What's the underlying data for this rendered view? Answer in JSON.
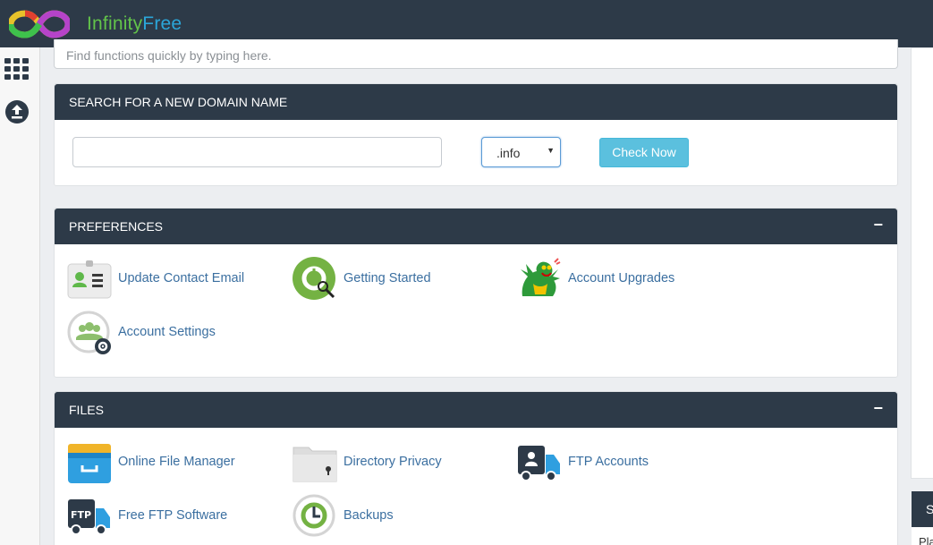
{
  "header": {
    "brand_part1": "Infinity",
    "brand_part2": "Free",
    "brand_colors": {
      "infinity": "#62c34a",
      "free": "#2ba6d9"
    },
    "bar_color": "#2d3a48"
  },
  "sidebar": {
    "items": [
      {
        "icon": "grid-icon"
      },
      {
        "icon": "upload-icon"
      }
    ]
  },
  "search": {
    "placeholder": "Find functions quickly by typing here."
  },
  "domain_search": {
    "title": "SEARCH FOR A NEW DOMAIN NAME",
    "input_value": "",
    "tld_selected": ".info",
    "button_label": "Check Now",
    "button_color": "#5bc0de"
  },
  "preferences": {
    "title": "PREFERENCES",
    "collapse_symbol": "−",
    "items": [
      {
        "label": "Update Contact Email",
        "icon": "contact-card-icon"
      },
      {
        "label": "Getting Started",
        "icon": "getting-started-icon"
      },
      {
        "label": "Account Upgrades",
        "icon": "dragon-icon"
      },
      {
        "label": "Account Settings",
        "icon": "user-settings-icon"
      }
    ]
  },
  "files": {
    "title": "FILES",
    "collapse_symbol": "−",
    "items": [
      {
        "label": "Online File Manager",
        "icon": "file-cabinet-icon"
      },
      {
        "label": "Directory Privacy",
        "icon": "locked-folder-icon"
      },
      {
        "label": "FTP Accounts",
        "icon": "ftp-truck-user-icon"
      },
      {
        "label": "Free FTP Software",
        "icon": "ftp-truck-icon"
      },
      {
        "label": "Backups",
        "icon": "backup-clock-icon"
      }
    ]
  },
  "right_panel": {
    "head_text": "S",
    "body_text": "Pla"
  }
}
